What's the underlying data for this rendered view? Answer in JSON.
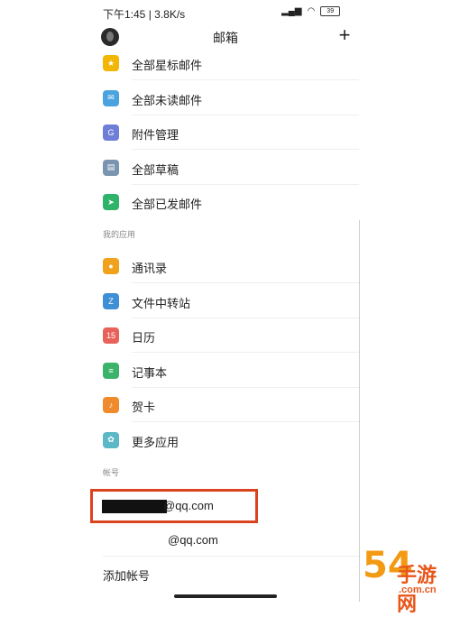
{
  "status": {
    "time": "下午1:45",
    "speed": "3.8K/s",
    "battery": "39"
  },
  "header": {
    "title": "邮箱",
    "add_icon": "+"
  },
  "folders": [
    {
      "label": "全部星标邮件",
      "icon": "star-icon",
      "color": "#f2b705",
      "glyph": "★"
    },
    {
      "label": "全部未读邮件",
      "icon": "envelope-icon",
      "color": "#4aa3df",
      "glyph": "✉"
    },
    {
      "label": "附件管理",
      "icon": "attachment-icon",
      "color": "#6f7fd8",
      "glyph": "G"
    },
    {
      "label": "全部草稿",
      "icon": "draft-icon",
      "color": "#7b94b0",
      "glyph": "▤"
    },
    {
      "label": "全部已发邮件",
      "icon": "sent-icon",
      "color": "#2fb36a",
      "glyph": "➤"
    }
  ],
  "apps_section": "我的应用",
  "apps": [
    {
      "label": "通讯录",
      "icon": "contacts-icon",
      "color": "#f0a21c",
      "glyph": "●"
    },
    {
      "label": "文件中转站",
      "icon": "file-transfer-icon",
      "color": "#3e8fd6",
      "glyph": "Z"
    },
    {
      "label": "日历",
      "icon": "calendar-icon",
      "color": "#e8625a",
      "glyph": "15"
    },
    {
      "label": "记事本",
      "icon": "notepad-icon",
      "color": "#3bb36a",
      "glyph": "≡"
    },
    {
      "label": "贺卡",
      "icon": "greeting-card-icon",
      "color": "#ef8b2c",
      "glyph": "♪"
    },
    {
      "label": "更多应用",
      "icon": "more-apps-icon",
      "color": "#5bb8c7",
      "glyph": "✿"
    }
  ],
  "accounts_section": "帐号",
  "accounts": [
    {
      "address": "@qq.com"
    },
    {
      "address": "@qq.com"
    }
  ],
  "add_account": "添加帐号",
  "watermark": {
    "number": "54",
    "mark": "手游网",
    "domain": ".com.cn"
  }
}
